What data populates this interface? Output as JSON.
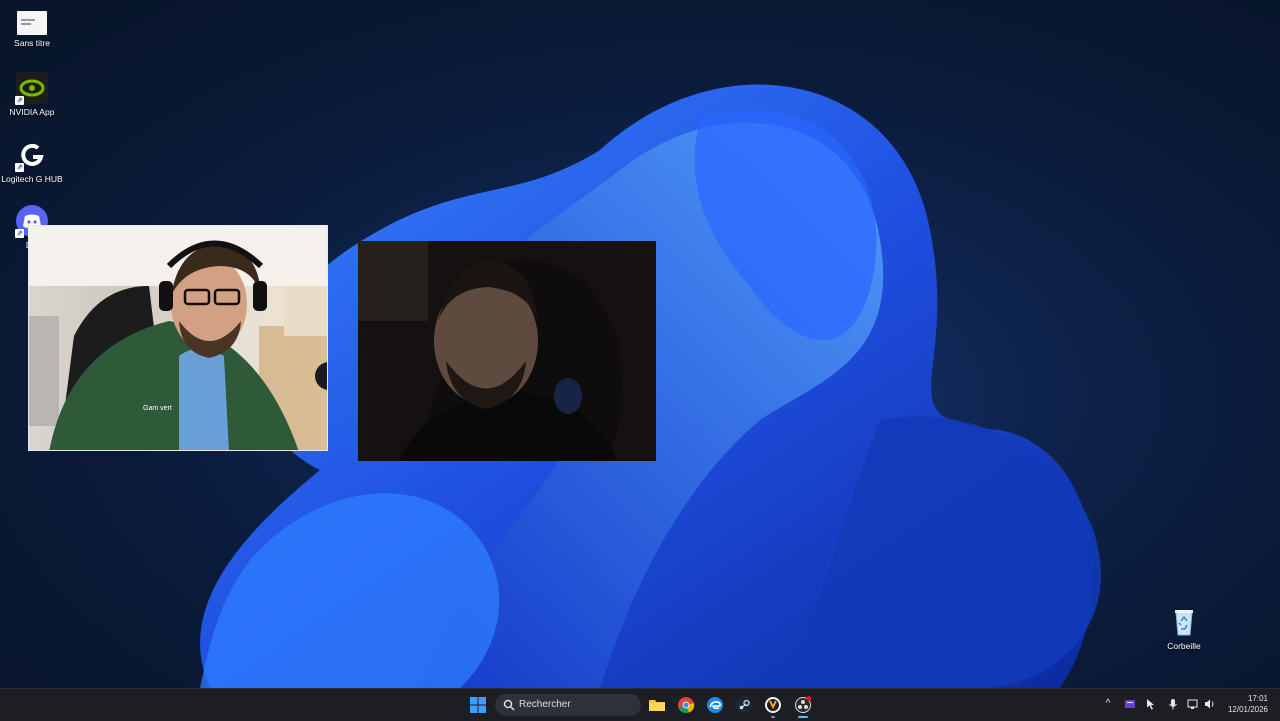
{
  "desktop": {
    "icons": [
      {
        "label": "Sans titre",
        "icon": "blank-document-icon"
      },
      {
        "label": "NVIDIA App",
        "icon": "nvidia-icon"
      },
      {
        "label": "Logitech G HUB",
        "icon": "logitech-g-icon"
      },
      {
        "label": "Dis",
        "icon": "discord-icon"
      },
      {
        "label": "Corbeille",
        "icon": "recycle-bin-icon"
      }
    ]
  },
  "webcam": {
    "left_shirt_logo": "Gam vert"
  },
  "taskbar": {
    "search_placeholder": "Rechercher",
    "apps": [
      "start-icon",
      "file-explorer-icon",
      "chrome-icon",
      "edge-icon",
      "steam-icon",
      "overwatch-icon",
      "obs-icon"
    ],
    "clock": {
      "time": "17:01",
      "date": "12/01/2026"
    }
  }
}
